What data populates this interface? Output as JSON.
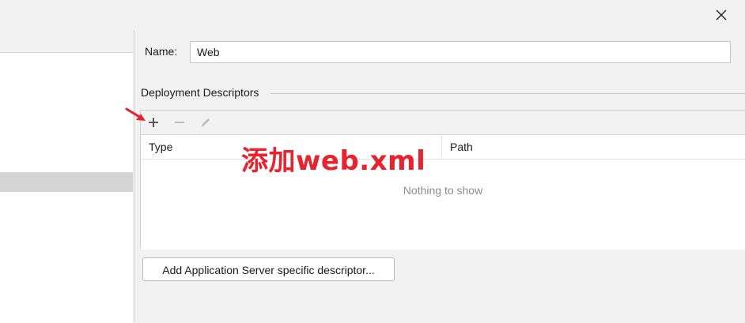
{
  "titlebar": {
    "close_icon": "close-icon"
  },
  "form": {
    "name_label": "Name:",
    "name_value": "Web"
  },
  "deployment": {
    "section_title": "Deployment Descriptors",
    "toolbar": {
      "add_icon": "plus-icon",
      "remove_icon": "minus-icon",
      "edit_icon": "pencil-icon"
    },
    "columns": [
      "Type",
      "Path"
    ],
    "empty_text": "Nothing to show"
  },
  "add_server_button_label": "Add Application Server specific descriptor...",
  "annotation": {
    "text": "添加web.xml",
    "color": "#e8232d"
  }
}
